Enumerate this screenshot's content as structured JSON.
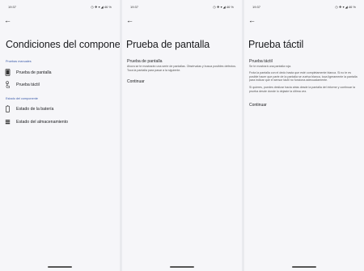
{
  "panels": [
    {
      "status_time": "19:37",
      "status_icons": "◷ ❖ ▾ ◢ 46 %",
      "title": "Condiciones del componente",
      "sections": [
        {
          "header": "Pruebas manuales",
          "items": [
            {
              "label": "Prueba de pantalla",
              "icon": "phone-icon"
            },
            {
              "label": "Prueba táctil",
              "icon": "touch-icon"
            }
          ]
        },
        {
          "header": "Estado del componente",
          "items": [
            {
              "label": "Estado de la batería",
              "icon": "battery-icon"
            },
            {
              "label": "Estado del almacenamiento",
              "icon": "storage-icon"
            }
          ]
        }
      ]
    },
    {
      "status_time": "19:37",
      "status_icons": "◷ ❖ ▾ ◢ 46 %",
      "title": "Prueba de pantalla",
      "subtitle": "Prueba de pantalla",
      "desc": "Ahora se te mostrarán una serie de pantallas. Obsérvalas y busca posibles defectos. Toca la pantalla para pasar a la siguiente.",
      "action": "Continuar"
    },
    {
      "status_time": "19:37",
      "status_icons": "◷ ❖ ▾ ◢ 46 %",
      "title": "Prueba táctil",
      "subtitle": "Prueba táctil",
      "desc1": "Se te mostrará una pantalla roja.",
      "desc2": "Frota la pantalla con el dedo hasta que esté completamente blanca. Si no te es posible hacer que parte de la pantalla se vuelva blanca, toca ligeramente la pantalla para indicar que el sensor táctil no funciona adecuadamente.",
      "desc3": "Si quieres, puedes deslizar hacia atrás desde la pantalla del informe y continuar la prueba desde donde lo dejaste la última vez.",
      "action": "Continuar"
    }
  ]
}
